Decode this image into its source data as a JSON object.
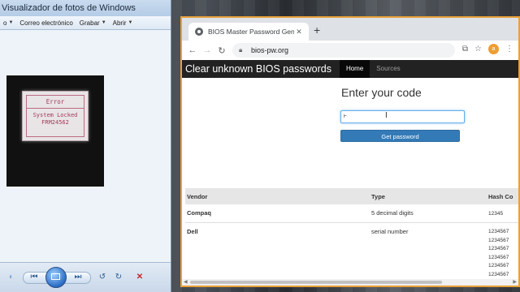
{
  "photo_viewer": {
    "title": "Visualizador de fotos de Windows",
    "menu": [
      {
        "label": "o",
        "has_dropdown": true
      },
      {
        "label": "Correo electrónico",
        "has_dropdown": false
      },
      {
        "label": "Grabar",
        "has_dropdown": true
      },
      {
        "label": "Abrir",
        "has_dropdown": true
      }
    ],
    "photo_screen": {
      "error": "Error",
      "line1": "System Locked",
      "line2": "FRM24562"
    },
    "controls": [
      "previous-icon",
      "slideshow-icon",
      "next-icon",
      "rotate-ccw-icon",
      "rotate-cw-icon",
      "delete-icon"
    ]
  },
  "browser": {
    "tab_title": "BIOS Master Password Generato",
    "new_tab_label": "+",
    "url": "bios-pw.org",
    "profile_initial": "a",
    "accent_color": "#e8a13a"
  },
  "page": {
    "brand": "Clear unknown BIOS passwords",
    "nav": [
      {
        "label": "Home",
        "active": true
      },
      {
        "label": "Sources",
        "active": false
      }
    ],
    "heading": "Enter your code",
    "code_input_value": "F",
    "button_label": "Get password",
    "table": {
      "headers": [
        "Vendor",
        "Type",
        "Hash Co"
      ],
      "rows": [
        {
          "vendor": "Compaq",
          "type": "5 decimal digits",
          "hashes": [
            "12345"
          ]
        },
        {
          "vendor": "Dell",
          "type": "serial number",
          "hashes": [
            "1234567",
            "1234567",
            "1234567",
            "1234567",
            "1234567",
            "1234567",
            "1234567"
          ]
        }
      ]
    }
  }
}
